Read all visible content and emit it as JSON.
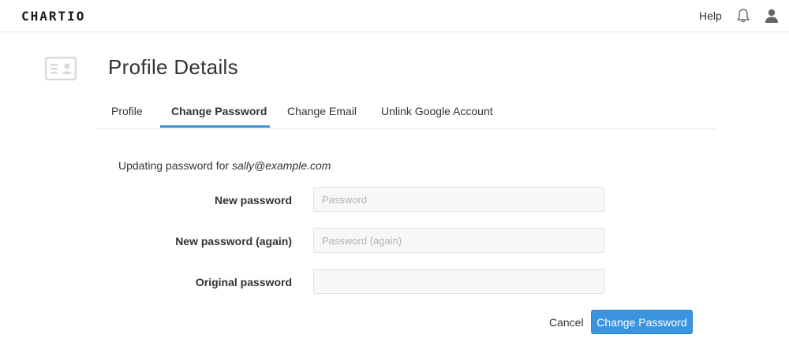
{
  "header": {
    "logo": "CHARTIO",
    "help_label": "Help",
    "icons": [
      "bell-icon",
      "user-icon"
    ]
  },
  "page": {
    "title": "Profile Details",
    "icon": "profile-card-icon"
  },
  "tabs": [
    {
      "label": "Profile",
      "active": false
    },
    {
      "label": "Change Password",
      "active": true
    },
    {
      "label": "Change Email",
      "active": false
    },
    {
      "label": "Unlink Google Account",
      "active": false
    }
  ],
  "form": {
    "intro_prefix": "Updating password for ",
    "email": "sally@example.com",
    "fields": [
      {
        "label": "New password",
        "value": "",
        "placeholder": "Password"
      },
      {
        "label": "New password (again)",
        "value": "",
        "placeholder": "Password (again)"
      },
      {
        "label": "Original password",
        "value": "",
        "placeholder": ""
      }
    ],
    "cancel_label": "Cancel",
    "submit_label": "Change Password"
  },
  "colors": {
    "accent": "#3a94de",
    "input_bg": "#f7f7f7",
    "border": "#e3e3e3"
  }
}
